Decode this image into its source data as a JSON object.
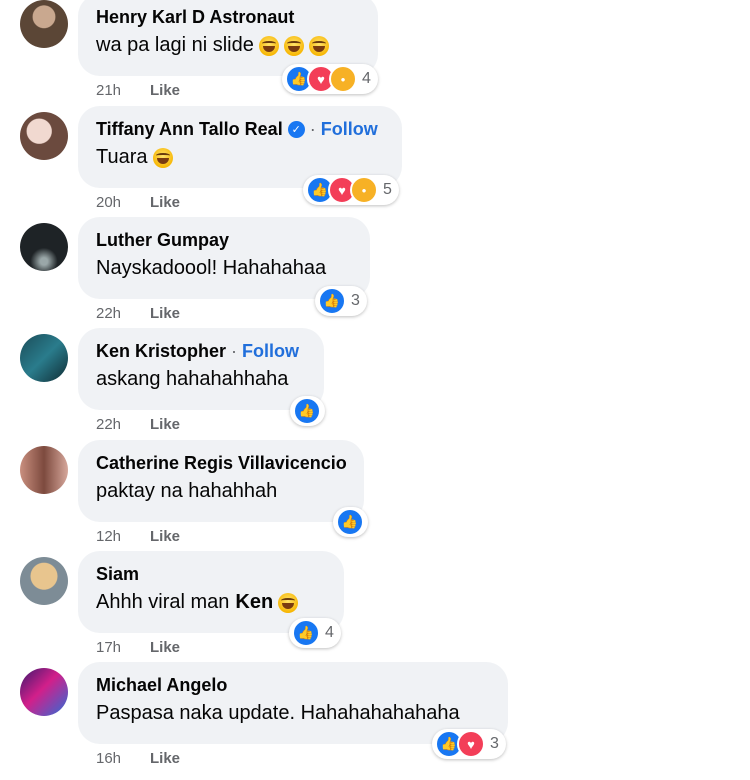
{
  "comments": [
    {
      "author": "Henry Karl D Astronaut",
      "verified": false,
      "follow": "",
      "text": "wa pa lagi ni slide",
      "mention": "",
      "emoji_count": 3,
      "reactions": [
        "like-icon",
        "love-icon",
        "wow-icon"
      ],
      "reaction_count": "4",
      "time": "21h",
      "like": "Like"
    },
    {
      "author": "Tiffany Ann Tallo Real",
      "verified": true,
      "follow": "Follow",
      "text": "Tuara",
      "mention": "",
      "emoji_count": 1,
      "reactions": [
        "like-icon",
        "love-icon",
        "care-icon"
      ],
      "reaction_count": "5",
      "time": "20h",
      "like": "Like"
    },
    {
      "author": "Luther Gumpay",
      "verified": false,
      "follow": "",
      "text": "Nayskadoool! Hahahahaa",
      "mention": "",
      "emoji_count": 0,
      "reactions": [
        "like-icon"
      ],
      "reaction_count": "3",
      "time": "22h",
      "like": "Like"
    },
    {
      "author": "Ken Kristopher",
      "verified": false,
      "follow": "Follow",
      "text": "askang hahahahhaha",
      "mention": "",
      "emoji_count": 0,
      "reactions": [
        "like-icon"
      ],
      "reaction_count": "",
      "time": "22h",
      "like": "Like"
    },
    {
      "author": "Catherine Regis Villavicencio",
      "verified": false,
      "follow": "",
      "text": "paktay na hahahhah",
      "mention": "",
      "emoji_count": 0,
      "reactions": [
        "like-icon"
      ],
      "reaction_count": "",
      "time": "12h",
      "like": "Like"
    },
    {
      "author": "Siam",
      "verified": false,
      "follow": "",
      "text": "Ahhh viral man",
      "mention": "Ken",
      "emoji_count": 1,
      "reactions": [
        "like-icon"
      ],
      "reaction_count": "4",
      "time": "17h",
      "like": "Like"
    },
    {
      "author": "Michael Angelo",
      "verified": false,
      "follow": "",
      "text": "Paspasa naka update. Hahahahahahaha",
      "mention": "",
      "emoji_count": 0,
      "reactions": [
        "like-icon",
        "love-icon"
      ],
      "reaction_count": "3",
      "time": "16h",
      "like": "Like"
    }
  ],
  "colors": {
    "accent": "#216fdb",
    "bubble": "#f0f2f5",
    "meta": "#65676b",
    "like_reaction": "#1877f2",
    "love_reaction": "#f33e58"
  }
}
